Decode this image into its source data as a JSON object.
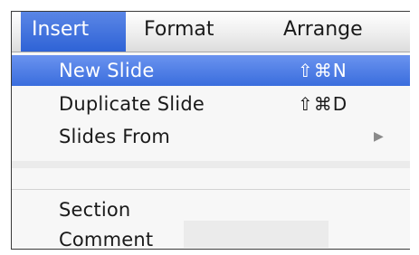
{
  "menubar": {
    "items": [
      {
        "label": "Insert",
        "active": true
      },
      {
        "label": "Format",
        "active": false
      },
      {
        "label": "Arrange",
        "active": false
      }
    ]
  },
  "dropdown": {
    "items": [
      {
        "label": "New Slide",
        "shortcut": "⇧⌘N",
        "highlighted": true
      },
      {
        "label": "Duplicate Slide",
        "shortcut": "⇧⌘D",
        "highlighted": false
      },
      {
        "label": "Slides From",
        "submenu_icon": "submenu-arrow-icon",
        "submenu_glyph": "▶"
      },
      {
        "label": "Section"
      },
      {
        "label": "Comment"
      }
    ]
  },
  "colors": {
    "highlight": "#3a6ddd",
    "text": "#1a1a1a"
  }
}
